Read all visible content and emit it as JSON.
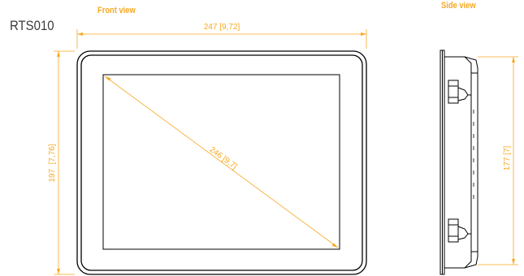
{
  "model": "RTS010",
  "front_view": {
    "heading": "Front view",
    "width_label": "247 [9,72]",
    "height_label": "197  [7,76]",
    "diagonal_label": "246 [9,7]"
  },
  "side_view": {
    "heading": "Side view",
    "height_label": "177 [7]"
  },
  "colors": {
    "dimension": "#f7a823",
    "outline": "#000000",
    "text": "#3a3a3a"
  }
}
